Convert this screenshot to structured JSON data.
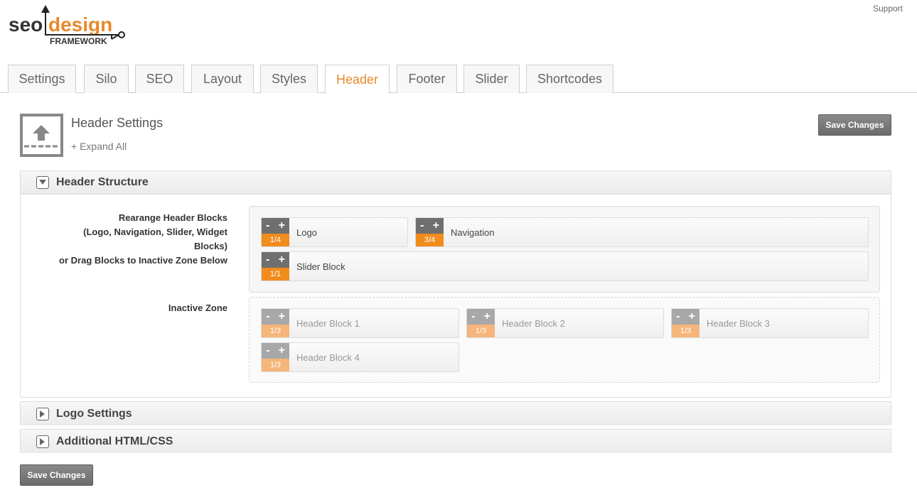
{
  "brand": {
    "seo": "seo",
    "design": "design",
    "framework": "FRAMEWORK"
  },
  "top_links": {
    "support": "Support"
  },
  "tabs": [
    {
      "label": "Settings",
      "active": false
    },
    {
      "label": "Silo",
      "active": false
    },
    {
      "label": "SEO",
      "active": false
    },
    {
      "label": "Layout",
      "active": false
    },
    {
      "label": "Styles",
      "active": false
    },
    {
      "label": "Header",
      "active": true
    },
    {
      "label": "Footer",
      "active": false
    },
    {
      "label": "Slider",
      "active": false
    },
    {
      "label": "Shortcodes",
      "active": false
    }
  ],
  "page": {
    "title": "Header Settings",
    "expand_all": "+ Expand All",
    "save_label": "Save Changes"
  },
  "sections": {
    "structure": {
      "title": "Header Structure",
      "rearrange_label": [
        "Rearange Header Blocks",
        "(Logo, Navigation, Slider, Widget",
        "Blocks)",
        "or Drag Blocks to Inactive Zone Below"
      ],
      "inactive_label": "Inactive Zone",
      "active_blocks": [
        {
          "name": "Logo",
          "size": "1/4"
        },
        {
          "name": "Navigation",
          "size": "3/4"
        },
        {
          "name": "Slider Block",
          "size": "1/1"
        }
      ],
      "inactive_blocks": [
        {
          "name": "Header Block 1",
          "size": "1/3"
        },
        {
          "name": "Header Block 2",
          "size": "1/3"
        },
        {
          "name": "Header Block 3",
          "size": "1/3"
        },
        {
          "name": "Header Block 4",
          "size": "1/3"
        }
      ]
    },
    "logo": {
      "title": "Logo Settings"
    },
    "html": {
      "title": "Additional HTML/CSS"
    }
  },
  "controls": {
    "minus": "-",
    "plus": "+"
  },
  "colors": {
    "accent": "#e8892b",
    "block_orange": "#f18c1d",
    "button_gray": "#777777"
  },
  "icons": {
    "header_settings": "upload-arrow-icon",
    "collapse": "triangle-down-icon",
    "expand": "triangle-right-icon"
  }
}
